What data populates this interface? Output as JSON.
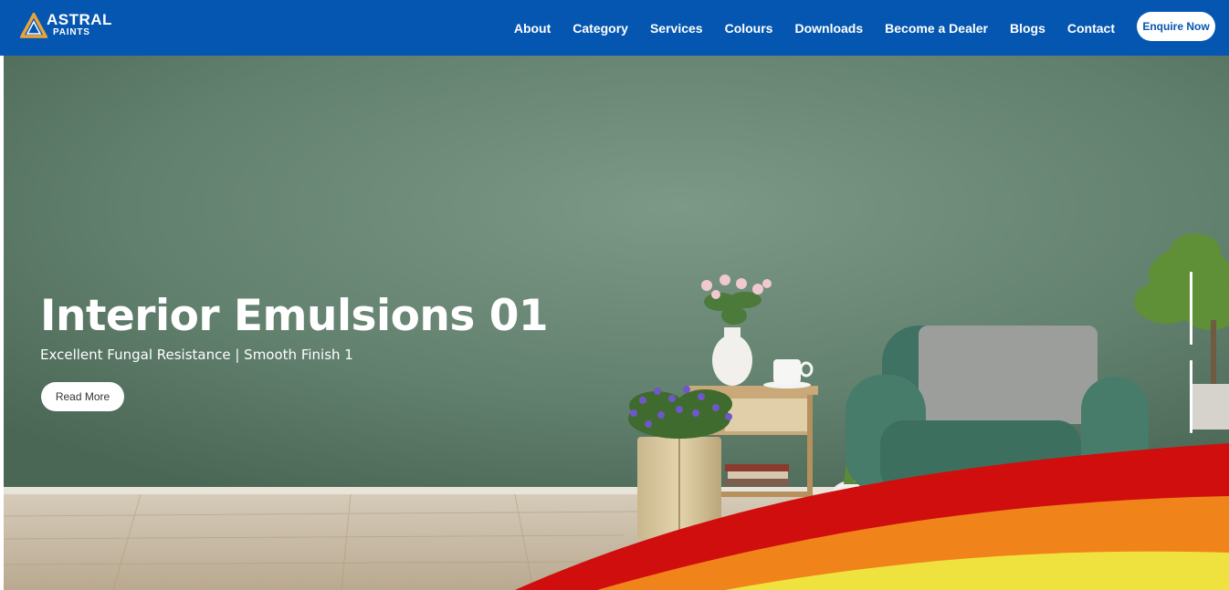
{
  "brand": {
    "name_line1": "ASTRAL",
    "name_line2": "PAINTS"
  },
  "nav": {
    "items": [
      {
        "label": "About"
      },
      {
        "label": "Category"
      },
      {
        "label": "Services"
      },
      {
        "label": "Colours"
      },
      {
        "label": "Downloads"
      },
      {
        "label": "Become a Dealer"
      },
      {
        "label": "Blogs"
      },
      {
        "label": "Contact"
      }
    ],
    "cta_label": "Enquire Now"
  },
  "hero": {
    "title": "Interior Emulsions 01",
    "subtitle": "Excellent Fungal Resistance | Smooth Finish 1",
    "button_label": "Read More",
    "slides_visible": 2
  },
  "colors": {
    "nav_background": "#0556b0",
    "wall_green": "#6b8a77",
    "wave_red": "#d10e0e",
    "wave_orange": "#f0841a",
    "wave_yellow": "#efe23e"
  }
}
